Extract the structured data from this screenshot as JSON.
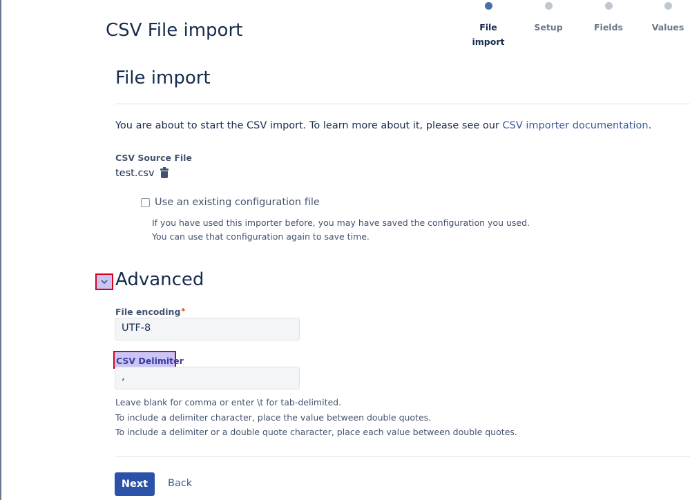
{
  "page": {
    "title": "CSV File import"
  },
  "stepper": {
    "steps": [
      {
        "line1": "File",
        "line2": "import",
        "active": true
      },
      {
        "line1": "Setup",
        "line2": "",
        "active": false
      },
      {
        "line1": "Fields",
        "line2": "",
        "active": false
      },
      {
        "line1": "Values",
        "line2": "",
        "active": false
      }
    ]
  },
  "section": {
    "title": "File import",
    "intro_text": "You are about to start the CSV import. To learn more about it, please see our ",
    "intro_link": "CSV importer documentation",
    "intro_end": "."
  },
  "source": {
    "label": "CSV Source File",
    "filename": "test.csv"
  },
  "config": {
    "checkbox_label": "Use an existing configuration file",
    "checked": false,
    "help_line1": "If you have used this importer before, you may have saved the configuration you used.",
    "help_line2": "You can use that configuration again to save time."
  },
  "advanced": {
    "title": "Advanced",
    "encoding_label": "File encoding",
    "required_marker": "*",
    "encoding_value": "UTF-8",
    "delimiter_label": "CSV Delimiter",
    "delimiter_value": ",",
    "help_line1": "Leave blank for comma or enter \\t for tab-delimited.",
    "help_line2": "To include a delimiter character, place the value between double quotes.",
    "help_line3": "To include a delimiter or a double quote character, place each value between double quotes."
  },
  "actions": {
    "next_label": "Next",
    "back_label": "Back"
  },
  "colors": {
    "primary": "#2952a8",
    "link": "#3b5b99",
    "highlight": "#c9c6f5",
    "highlight_border": "#d9001b"
  }
}
